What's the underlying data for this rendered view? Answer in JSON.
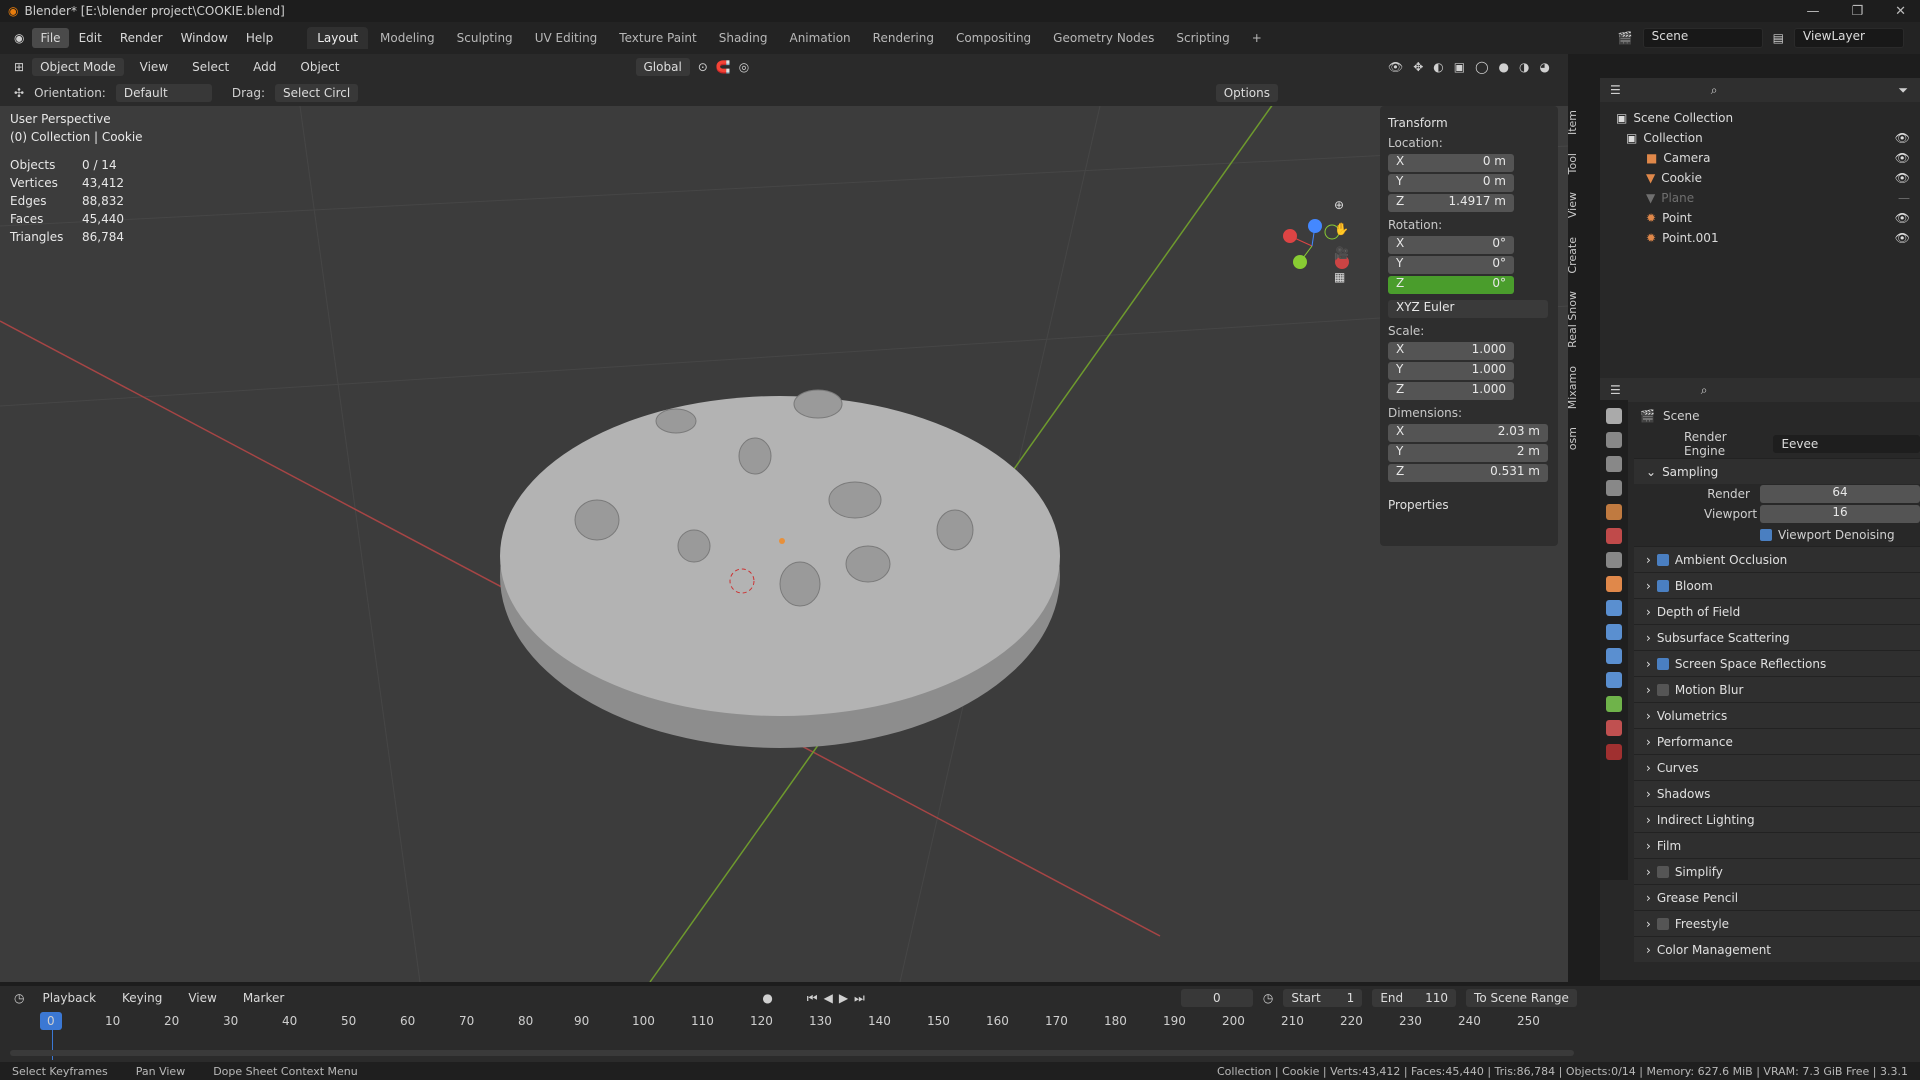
{
  "title_bar": {
    "text": "Blender* [E:\\blender project\\COOKIE.blend]"
  },
  "menubar": {
    "items": [
      "File",
      "Edit",
      "Render",
      "Window",
      "Help"
    ],
    "workspaces": [
      "Layout",
      "Modeling",
      "Sculpting",
      "UV Editing",
      "Texture Paint",
      "Shading",
      "Animation",
      "Rendering",
      "Compositing",
      "Geometry Nodes",
      "Scripting"
    ],
    "scene": "Scene",
    "view_layer": "ViewLayer"
  },
  "viewport_header": {
    "mode": "Object Mode",
    "menus": [
      "View",
      "Select",
      "Add",
      "Object"
    ],
    "transform_orientation": "Global",
    "options": "Options"
  },
  "tool_settings": {
    "orientation_label": "Orientation:",
    "orientation": "Default",
    "drag_label": "Drag:",
    "drag": "Select Circl"
  },
  "overlay": {
    "view_name": "User Perspective",
    "collection": "(0) Collection | Cookie",
    "stats": [
      {
        "label": "Objects",
        "value": "0 / 14"
      },
      {
        "label": "Vertices",
        "value": "43,412"
      },
      {
        "label": "Edges",
        "value": "88,832"
      },
      {
        "label": "Faces",
        "value": "45,440"
      },
      {
        "label": "Triangles",
        "value": "86,784"
      }
    ]
  },
  "n_panel": {
    "title": "Transform",
    "location_label": "Location:",
    "location": {
      "x": "0 m",
      "y": "0 m",
      "z": "1.4917 m"
    },
    "rotation_label": "Rotation:",
    "rotation": {
      "x": "0°",
      "y": "0°",
      "z": "0°"
    },
    "rotation_mode": "XYZ Euler",
    "scale_label": "Scale:",
    "scale": {
      "x": "1.000",
      "y": "1.000",
      "z": "1.000"
    },
    "dimensions_label": "Dimensions:",
    "dimensions": {
      "x": "2.03 m",
      "y": "2 m",
      "z": "0.531 m"
    },
    "properties": "Properties",
    "tabs": [
      "Item",
      "Tool",
      "View",
      "Create",
      "Real Snow",
      "Mixamo",
      "osm"
    ]
  },
  "outliner": {
    "root": "Scene Collection",
    "collection": "Collection",
    "items": [
      {
        "name": "Camera"
      },
      {
        "name": "Cookie"
      },
      {
        "name": "Plane"
      },
      {
        "name": "Point"
      },
      {
        "name": "Point.001"
      }
    ]
  },
  "properties": {
    "scene_label": "Scene",
    "render_engine_label": "Render Engine",
    "render_engine": "Eevee",
    "sampling": "Sampling",
    "render_label": "Render",
    "render_samples": "64",
    "viewport_label": "Viewport",
    "viewport_samples": "16",
    "viewport_denoising": "Viewport Denoising",
    "sections": [
      {
        "label": "Ambient Occlusion",
        "checked": true
      },
      {
        "label": "Bloom",
        "checked": true
      },
      {
        "label": "Depth of Field"
      },
      {
        "label": "Subsurface Scattering"
      },
      {
        "label": "Screen Space Reflections",
        "checked": true
      },
      {
        "label": "Motion Blur",
        "checked": false
      },
      {
        "label": "Volumetrics"
      },
      {
        "label": "Performance"
      },
      {
        "label": "Curves"
      },
      {
        "label": "Shadows"
      },
      {
        "label": "Indirect Lighting"
      },
      {
        "label": "Film"
      },
      {
        "label": "Simplify",
        "checked": false
      },
      {
        "label": "Grease Pencil"
      },
      {
        "label": "Freestyle",
        "checked": false
      },
      {
        "label": "Color Management"
      }
    ]
  },
  "timeline": {
    "menus": [
      "Playback",
      "Keying",
      "View",
      "Marker"
    ],
    "current_frame": "0",
    "start_label": "Start",
    "start": "1",
    "end_label": "End",
    "end": "110",
    "scene_range": "To Scene Range",
    "ticks": [
      "0",
      "10",
      "20",
      "30",
      "40",
      "50",
      "60",
      "70",
      "80",
      "90",
      "100",
      "110",
      "120",
      "130",
      "140",
      "150",
      "160",
      "170",
      "180",
      "190",
      "200",
      "210",
      "220",
      "230",
      "240",
      "250"
    ]
  },
  "status_bar": {
    "left": [
      "Select Keyframes",
      "Pan View",
      "Dope Sheet Context Menu"
    ],
    "right": "Collection | Cookie | Verts:43,412 | Faces:45,440 | Tris:86,784 | Objects:0/14 | Memory: 627.6 MiB | VRAM: 7.3 GiB Free | 3.3.1"
  }
}
